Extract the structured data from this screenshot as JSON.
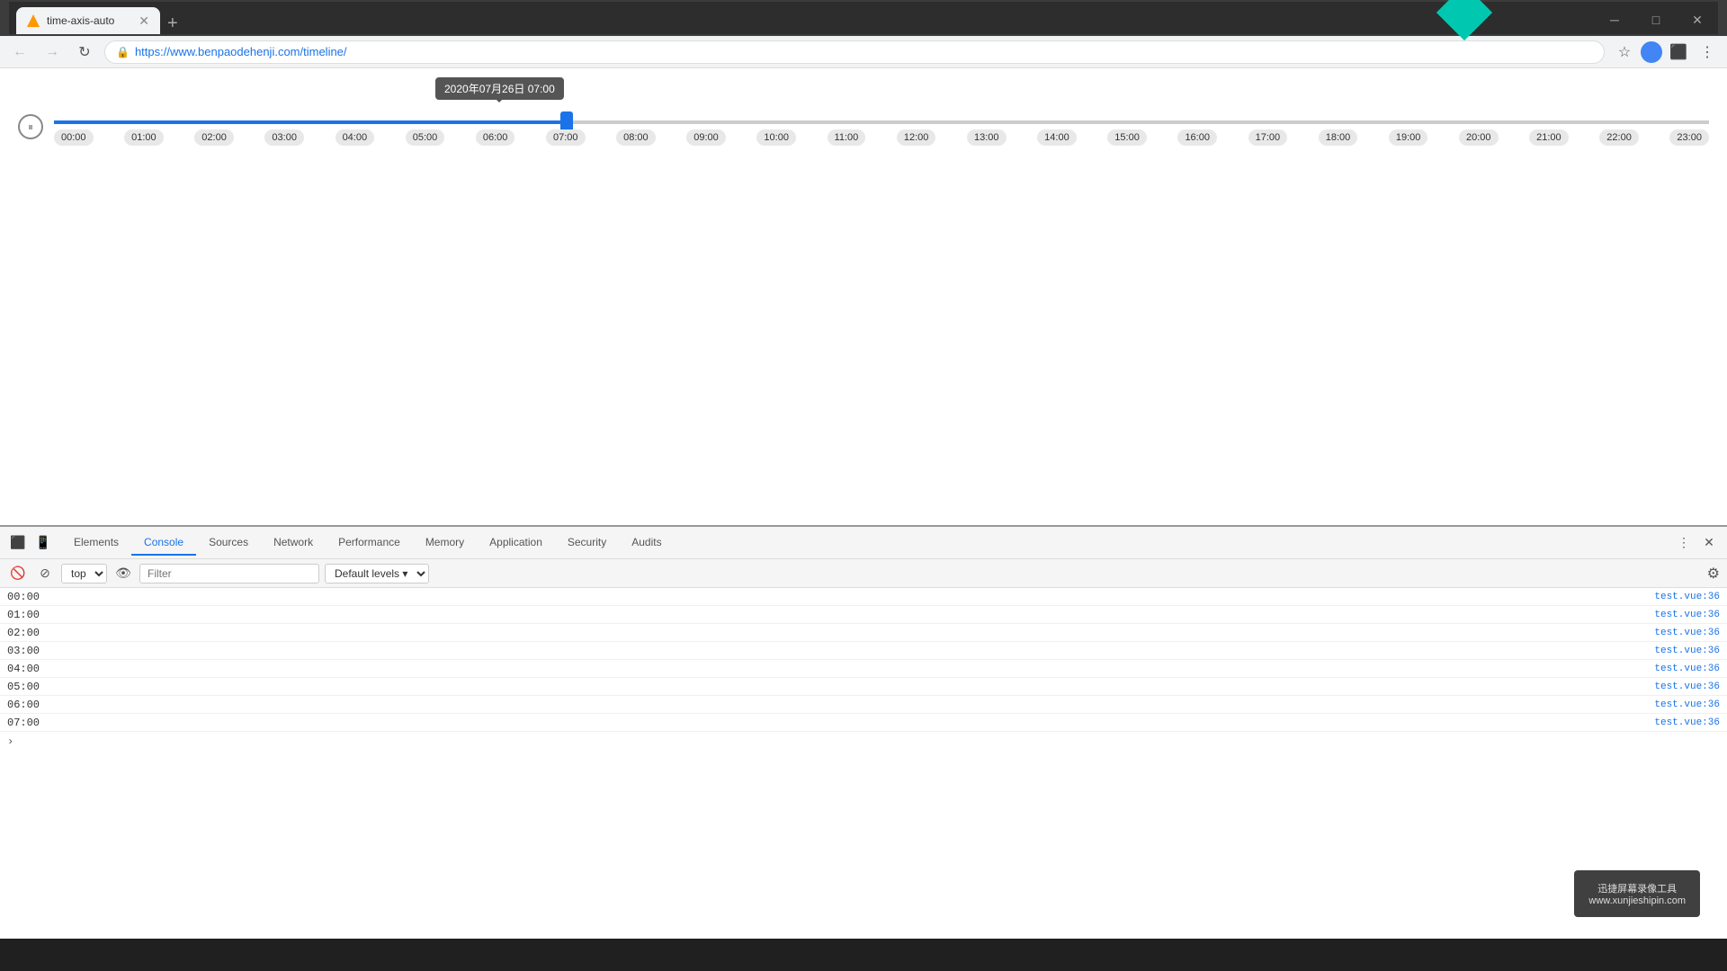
{
  "browser": {
    "tab_title": "time-axis-auto",
    "url": "https://www.benpaodehenji.com/timeline/",
    "new_tab_label": "+"
  },
  "page": {
    "tooltip": "2020年07月26日 07:00",
    "play_button_symbol": "⏸",
    "timeline_times": [
      "00:00",
      "01:00",
      "02:00",
      "03:00",
      "04:00",
      "05:00",
      "06:00",
      "07:00",
      "08:00",
      "09:00",
      "10:00",
      "11:00",
      "12:00",
      "13:00",
      "14:00",
      "15:00",
      "16:00",
      "17:00",
      "18:00",
      "19:00",
      "20:00",
      "21:00",
      "22:00",
      "23:00"
    ]
  },
  "devtools": {
    "tabs": [
      {
        "label": "Elements",
        "active": false
      },
      {
        "label": "Console",
        "active": true
      },
      {
        "label": "Sources",
        "active": false
      },
      {
        "label": "Network",
        "active": false
      },
      {
        "label": "Performance",
        "active": false
      },
      {
        "label": "Memory",
        "active": false
      },
      {
        "label": "Application",
        "active": false
      },
      {
        "label": "Security",
        "active": false
      },
      {
        "label": "Audits",
        "active": false
      }
    ],
    "console": {
      "context": "top",
      "filter_placeholder": "Filter",
      "level": "Default levels",
      "log_rows": [
        {
          "time": "00:00",
          "source": "test.vue:36"
        },
        {
          "time": "01:00",
          "source": "test.vue:36"
        },
        {
          "time": "02:00",
          "source": "test.vue:36"
        },
        {
          "time": "03:00",
          "source": "test.vue:36"
        },
        {
          "time": "04:00",
          "source": "test.vue:36"
        },
        {
          "time": "05:00",
          "source": "test.vue:36"
        },
        {
          "time": "06:00",
          "source": "test.vue:36"
        },
        {
          "time": "07:00",
          "source": "test.vue:36"
        }
      ]
    }
  },
  "watermark": {
    "line1": "迅捷屏幕录像工具",
    "line2": "www.xunjieshipin.com"
  }
}
